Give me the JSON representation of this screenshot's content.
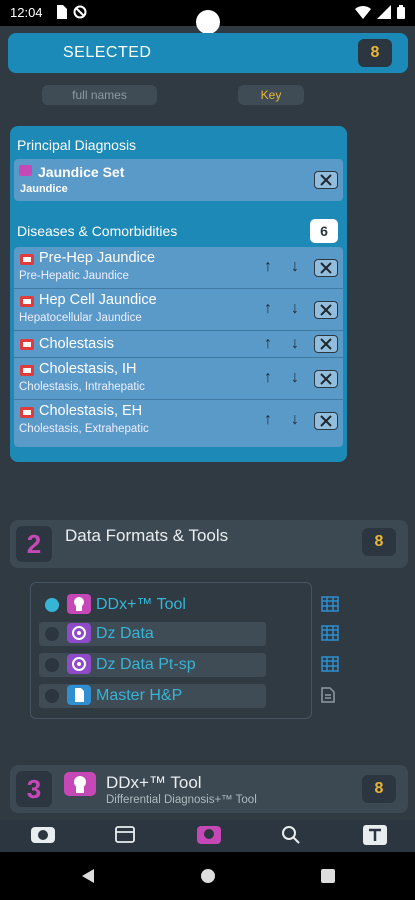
{
  "status": {
    "time": "12:04"
  },
  "selected": {
    "title": "SELECTED",
    "count": "8"
  },
  "toggles": {
    "full_names": "full names",
    "key": "Key"
  },
  "principal": {
    "heading": "Principal Diagnosis",
    "name": "Jaundice Set",
    "sub": "Jaundice"
  },
  "diseases": {
    "heading": "Diseases & Comorbidities",
    "count": "6",
    "items": [
      {
        "name": "Pre-Hep Jaundice",
        "sub": "Pre-Hepatic Jaundice"
      },
      {
        "name": "Hep Cell Jaundice",
        "sub": "Hepatocellular Jaundice"
      },
      {
        "name": "Cholestasis",
        "sub": ""
      },
      {
        "name": "Cholestasis, IH",
        "sub": "Cholestasis, Intrahepatic"
      },
      {
        "name": "Cholestasis, EH",
        "sub": "Cholestasis, Extrahepatic"
      }
    ]
  },
  "section2": {
    "number": "2",
    "title": "Data Formats & Tools",
    "count": "8"
  },
  "tools": [
    {
      "label": "DDx+™ Tool",
      "icon": "brain-icon",
      "selected": true
    },
    {
      "label": "Dz Data",
      "icon": "swirl-icon",
      "selected": false
    },
    {
      "label": "Dz Data Pt-sp",
      "icon": "swirl-icon",
      "selected": false
    },
    {
      "label": "Master H&P",
      "icon": "document-icon",
      "selected": false
    }
  ],
  "section3": {
    "number": "3",
    "title": "DDx+™ Tool",
    "subtitle": "Differential Diagnosis+™ Tool",
    "count": "8"
  },
  "colors": {
    "accent": "#1b8ab8",
    "magenta": "#c648b6",
    "gold": "#e8b638",
    "cyan": "#36b5d6"
  }
}
